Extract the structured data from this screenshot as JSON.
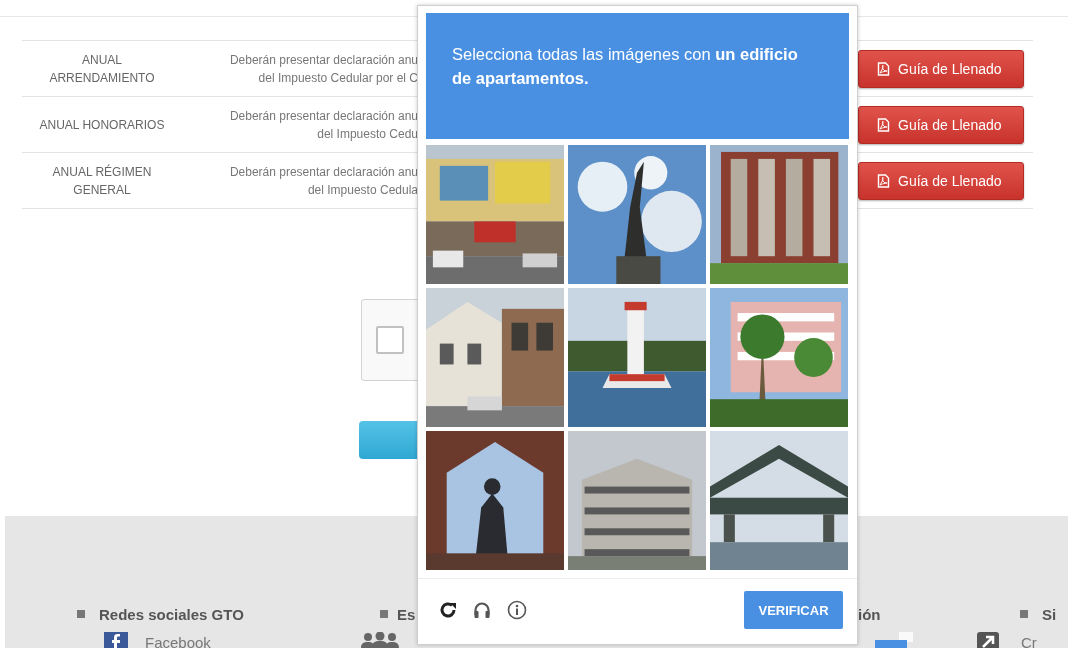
{
  "table": {
    "rows": [
      {
        "name_lines": [
          "ANUAL",
          "ARRENDAMIENTO"
        ],
        "description_lines": [
          "Deberán presentar declaración anu",
          "del Impuesto Cedular por el C"
        ],
        "button": "Guía de Llenado"
      },
      {
        "name_lines": [
          "ANUAL HONORARIOS"
        ],
        "description_lines": [
          "Deberán presentar declaración anu",
          "del Impuesto Cedu"
        ],
        "button": "Guía de Llenado"
      },
      {
        "name_lines": [
          "ANUAL RÉGIMEN",
          "GENERAL"
        ],
        "description_lines": [
          "Deberán presentar declaración anu",
          "del Impuesto Cedula"
        ],
        "button": "Guía de Llenado"
      }
    ]
  },
  "captcha_widget": {
    "checked": false
  },
  "captcha": {
    "instruction": "Selecciona todas las imágenes con **un edificio de apartamentos.**",
    "verify_button": "VERIFICAR"
  },
  "footer": {
    "columns": [
      {
        "heading": "Redes sociales GTO",
        "link": "Facebook"
      },
      {
        "heading": "Es"
      },
      {
        "heading": "ión"
      },
      {
        "heading": "Si",
        "link": "Cr"
      }
    ]
  }
}
